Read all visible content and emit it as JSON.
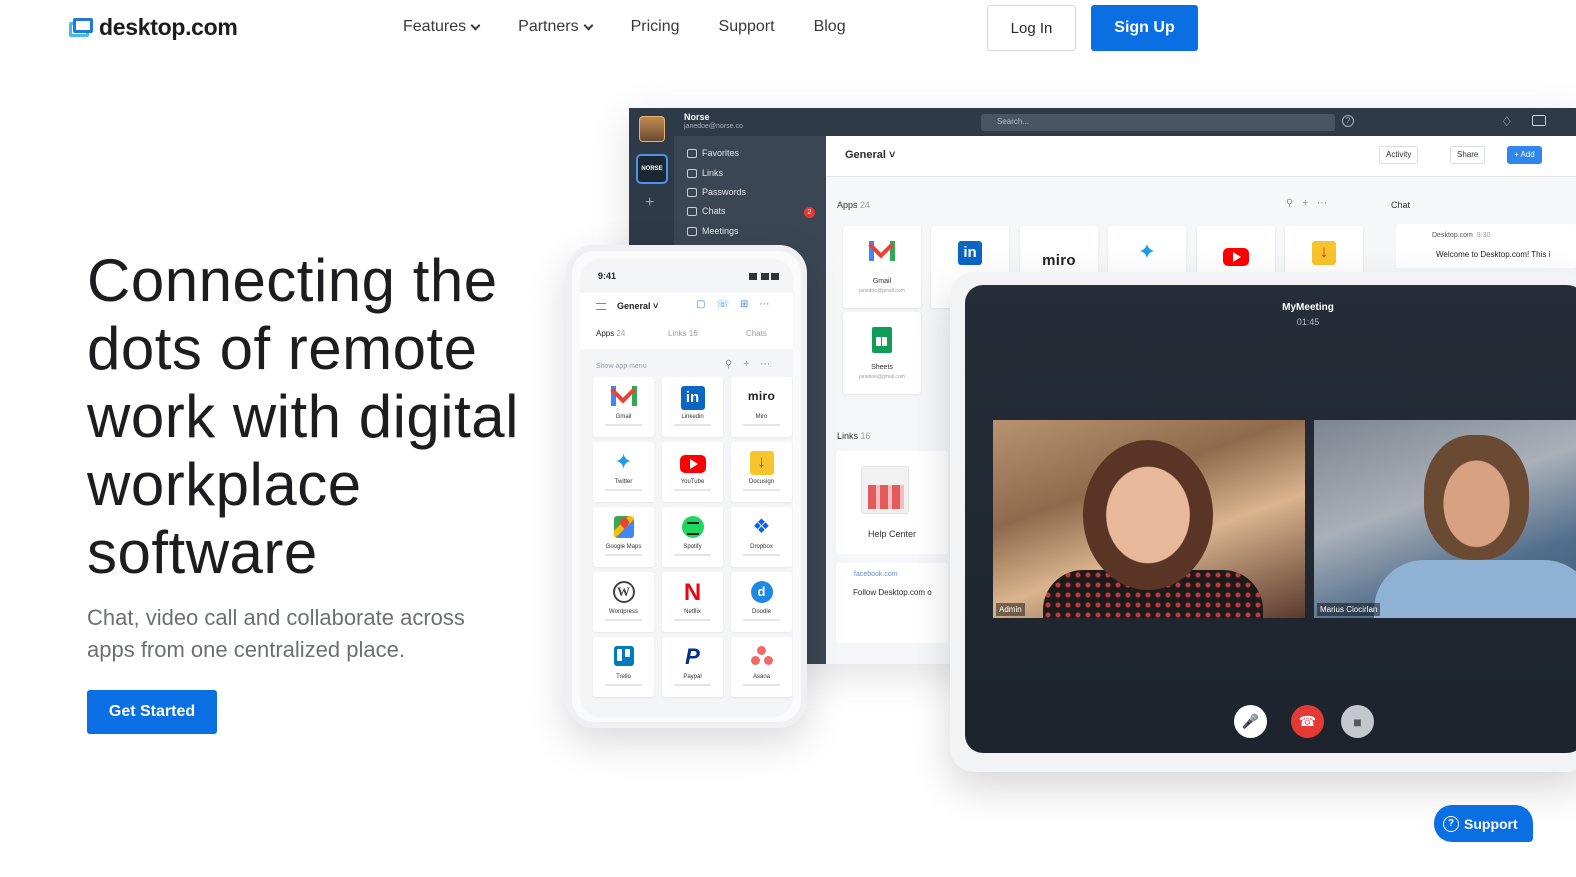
{
  "brand": {
    "name": "desktop.com",
    "accent": "#0a6fe2"
  },
  "nav": {
    "items": [
      {
        "label": "Features",
        "dropdown": true
      },
      {
        "label": "Partners",
        "dropdown": true
      },
      {
        "label": "Pricing",
        "dropdown": false
      },
      {
        "label": "Support",
        "dropdown": false
      },
      {
        "label": "Blog",
        "dropdown": false
      }
    ],
    "login_label": "Log In",
    "signup_label": "Sign Up"
  },
  "hero": {
    "title": "Connecting the dots of remote work with digital workplace software",
    "subtitle": "Chat, video call and collaborate across apps from one centralized place.",
    "cta_label": "Get Started"
  },
  "desktop_app": {
    "user_name": "Norse",
    "user_email": "janedoe@norse.co",
    "workspace_badge": "NORSE",
    "search_placeholder": "Search...",
    "sidebar": [
      "Favorites",
      "Links",
      "Passwords",
      "Chats",
      "Meetings"
    ],
    "chats_badge": "2",
    "channel": "General",
    "header_buttons": [
      "Activity",
      "Share",
      "+ Add"
    ],
    "apps_label": "Apps",
    "apps_count": "24",
    "links_label": "Links",
    "links_count": "16",
    "chat_label": "Chat",
    "apps": [
      {
        "name": "Gmail",
        "email": "janedoe@gmail.com",
        "icon": "gmail-icon"
      },
      {
        "name": "LinkedIn",
        "email": "",
        "icon": "linkedin-icon"
      },
      {
        "name": "Miro",
        "email": "",
        "icon": "miro-icon"
      },
      {
        "name": "Twitter",
        "email": "",
        "icon": "twitter-icon"
      },
      {
        "name": "YouTube",
        "email": "",
        "icon": "youtube-icon"
      },
      {
        "name": "Docusign",
        "email": "",
        "icon": "docusign-icon"
      }
    ],
    "sheets": {
      "name": "Sheets",
      "email": "janedoe@gmail.com"
    },
    "help_center": "Help Center",
    "fb_source": "facebook.com",
    "fb_title": "Follow Desktop.com o",
    "chat_from": "Desktop.com",
    "chat_time": "9:30",
    "chat_message": "Welcome to Desktop.com! This i"
  },
  "phone": {
    "time": "9:41",
    "channel": "General",
    "tabs": [
      {
        "label": "Apps",
        "count": "24"
      },
      {
        "label": "Links",
        "count": "16"
      },
      {
        "label": "Chats",
        "count": ""
      }
    ],
    "show_menu": "Show app menu",
    "apps": [
      {
        "name": "Gmail",
        "icon": "gmail-icon"
      },
      {
        "name": "Linkedin",
        "icon": "linkedin-icon"
      },
      {
        "name": "Miro",
        "icon": "miro-icon"
      },
      {
        "name": "Twitter",
        "icon": "twitter-icon"
      },
      {
        "name": "YouTube",
        "icon": "youtube-icon"
      },
      {
        "name": "Docusign",
        "icon": "docusign-icon"
      },
      {
        "name": "Google Maps",
        "icon": "google-maps-icon"
      },
      {
        "name": "Spotify",
        "icon": "spotify-icon"
      },
      {
        "name": "Dropbox",
        "icon": "dropbox-icon"
      },
      {
        "name": "Wordpress",
        "icon": "wordpress-icon"
      },
      {
        "name": "Netflix",
        "icon": "netflix-icon"
      },
      {
        "name": "Doodle",
        "icon": "doodle-icon"
      },
      {
        "name": "Trello",
        "icon": "trello-icon"
      },
      {
        "name": "Paypal",
        "icon": "paypal-icon"
      },
      {
        "name": "Asana",
        "icon": "asana-icon"
      }
    ]
  },
  "meeting": {
    "title": "MyMeeting",
    "time": "01:45",
    "participants": [
      "Admin",
      "Marius Ciocirlan"
    ]
  },
  "support_widget": {
    "label": "Support"
  }
}
